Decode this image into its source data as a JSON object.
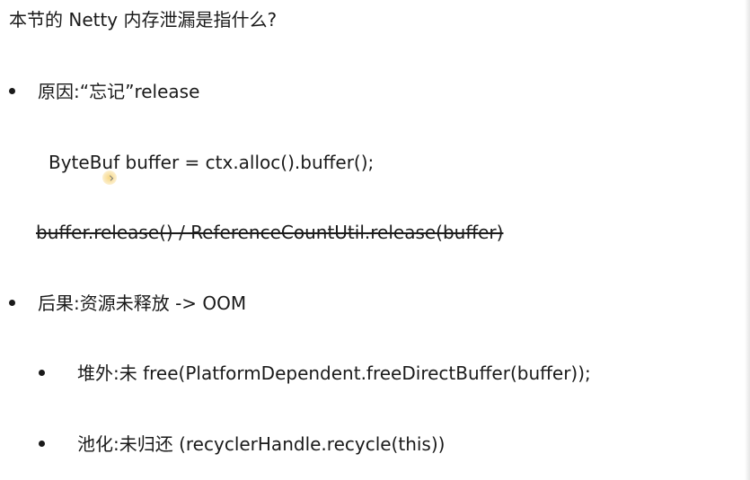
{
  "slide": {
    "title": "本节的 Netty 内存泄漏是指什么?",
    "items": [
      {
        "text": "原因:“忘记”release"
      },
      {
        "text": "ByteBuf buffer = ctx.alloc().buffer();"
      },
      {
        "text": "buffer.release() / ReferenceCountUtil.release(buffer)"
      },
      {
        "text": "后果:资源未释放 -> OOM"
      },
      {
        "text": "堆外:未 free(PlatformDependent.freeDirectBuffer(buffer));"
      },
      {
        "text": "池化:未归还 (recyclerHandle.recycle(this))"
      }
    ]
  }
}
